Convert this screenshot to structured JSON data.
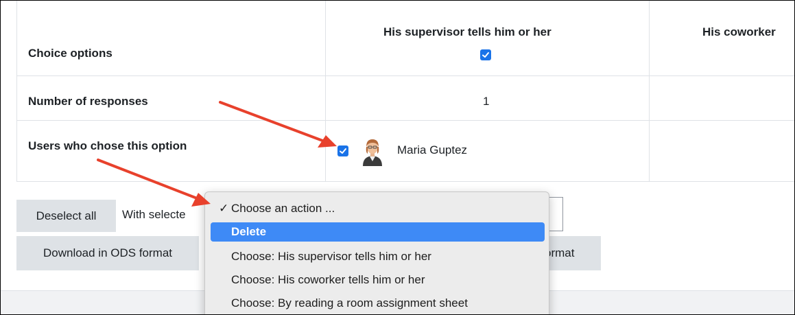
{
  "table": {
    "rows": {
      "choice_options": "Choice options",
      "number_of_responses": "Number of responses",
      "users_chose": "Users who chose this option"
    },
    "columns": [
      {
        "header": "His supervisor tells him or her",
        "responses": "1",
        "users": [
          "Maria Guptez"
        ]
      },
      {
        "header": "His coworker"
      }
    ]
  },
  "controls": {
    "deselect_all": "Deselect all",
    "with_selected": "With selecte",
    "download_ods": "Download in ODS format",
    "download_other_partial": "ormat"
  },
  "dropdown": {
    "options": [
      {
        "label": "Choose an action ...",
        "checked": true
      },
      {
        "label": "Delete",
        "highlighted": true
      },
      {
        "label": "Choose: His supervisor tells him or her"
      },
      {
        "label": "Choose: His coworker tells him or her"
      },
      {
        "label": "Choose: By reading a room assignment sheet"
      }
    ]
  },
  "colors": {
    "accent": "#1a73e8",
    "menu_highlight": "#3e8af6",
    "arrow": "#e8412c",
    "button_bg": "#dee2e6"
  }
}
